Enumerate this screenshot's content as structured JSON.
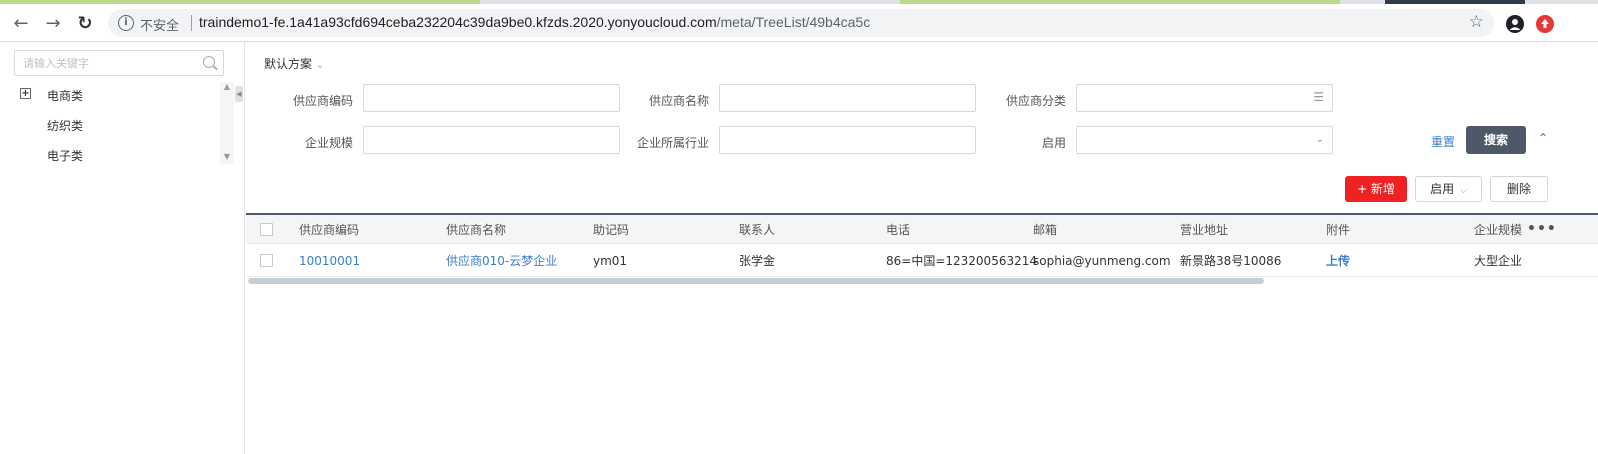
{
  "browser": {
    "insecure_label": "不安全",
    "url_host": "traindemo1-fe.1a41a93cfd694ceba232204c39da9be0.kfzds.2020.yonyoucloud.com",
    "url_path": "/meta/TreeList/49b4ca5c"
  },
  "tree": {
    "search_placeholder": "请输入关键字",
    "items": [
      {
        "label": "电商类",
        "expandable": true
      },
      {
        "label": "纺织类"
      },
      {
        "label": "电子类"
      }
    ]
  },
  "filter": {
    "scheme_label": "默认方案",
    "fields": [
      {
        "label": "供应商编码",
        "value": ""
      },
      {
        "label": "供应商名称",
        "value": ""
      },
      {
        "label": "供应商分类",
        "value": ""
      },
      {
        "label": "企业规模",
        "value": ""
      },
      {
        "label": "企业所属行业",
        "value": ""
      },
      {
        "label": "启用",
        "value": ""
      }
    ],
    "reset_label": "重置",
    "search_label": "搜索"
  },
  "toolbar": {
    "add_label": "+ 新增",
    "enable_label": "启用",
    "delete_label": "删除"
  },
  "table": {
    "columns": [
      "供应商编码",
      "供应商名称",
      "助记码",
      "联系人",
      "电话",
      "邮箱",
      "营业地址",
      "附件",
      "企业规模"
    ],
    "rows": [
      {
        "code": "10010001",
        "name": "供应商010-云梦企业",
        "mnemonic": "ym01",
        "contact": "张学金",
        "phone": "86=中国=123200563214",
        "email": "sophia@yunmeng.com",
        "address": "新景路38号10086",
        "attachment": "上传",
        "scale": "大型企业"
      }
    ]
  },
  "colors": {
    "accent_red": "#ee2223",
    "search_button": "#4e5869",
    "link_blue": "#3e7dca"
  }
}
